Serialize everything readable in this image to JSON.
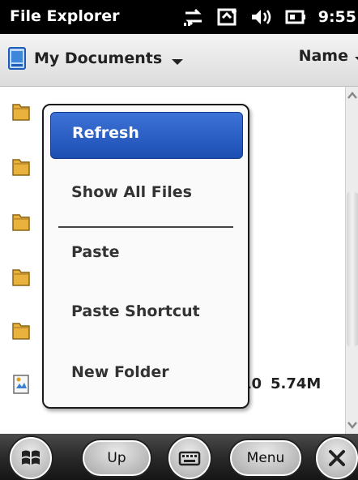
{
  "titlebar": {
    "title": "File Explorer",
    "time": "9:55",
    "status_icons": [
      "sync-icon",
      "connection-icon",
      "volume-icon",
      "battery-icon"
    ]
  },
  "header": {
    "folder": "My Documents",
    "sort": "Name"
  },
  "list": {
    "rows": [
      {
        "type": "folder",
        "name": ""
      },
      {
        "type": "folder",
        "name": ""
      },
      {
        "type": "folder",
        "name": ""
      },
      {
        "type": "folder",
        "name": ""
      },
      {
        "type": "folder",
        "name": ""
      },
      {
        "type": "file",
        "name": "",
        "date": "10",
        "size": "5.74M"
      }
    ]
  },
  "menu": {
    "items": [
      "Refresh",
      "Show All Files",
      "Paste",
      "Paste Shortcut",
      "New Folder"
    ],
    "selected": "Refresh"
  },
  "bottombar": {
    "up_label": "Up",
    "menu_label": "Menu"
  },
  "colors": {
    "accent": "#2a5fc6",
    "folder": "#e9b23c",
    "titlebar": "#000000"
  }
}
